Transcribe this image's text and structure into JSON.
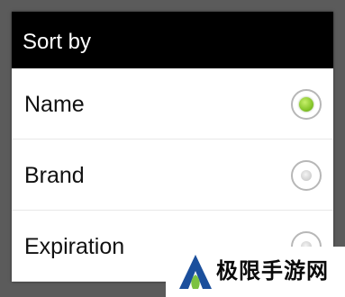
{
  "dialog": {
    "title": "Sort by",
    "options": [
      {
        "label": "Name",
        "selected": true
      },
      {
        "label": "Brand",
        "selected": false
      },
      {
        "label": "Expiration",
        "selected": false
      }
    ]
  },
  "watermark": {
    "text": "极限手游网"
  },
  "colors": {
    "title_bar": "#000000",
    "selected_radio": "#86c62a",
    "watermark_logo_blue": "#1b4f9c",
    "watermark_logo_green": "#7cc242"
  }
}
